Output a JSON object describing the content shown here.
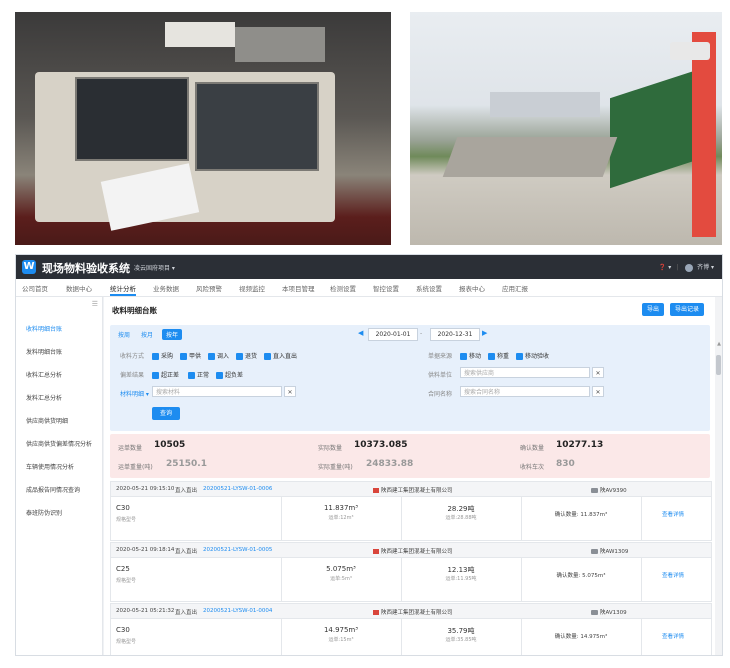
{
  "app": {
    "title": "现场物料验收系统",
    "project": "凌云固府项目 ▾",
    "user": "齐博 ▾",
    "help": "❓ ▾"
  },
  "nav": [
    "公司首页",
    "数据中心",
    "统计分析",
    "业务数据",
    "风险预警",
    "视频监控",
    "本项目管理",
    "检测设置",
    "智控设置",
    "系统设置",
    "报表中心",
    "应用汇报"
  ],
  "sidebar": [
    "收料明细台账",
    "发料明细台账",
    "收料汇总分析",
    "发料汇总分析",
    "供应商供货明细",
    "供应商供货偏差情况分析",
    "车辆使用情况分析",
    "成品报告同情况查询",
    "泰班防伪识别"
  ],
  "page": {
    "title": "收料明细台账",
    "export_label": "导出",
    "export_record_label": "导出记录"
  },
  "filters": {
    "tabs": [
      "按周",
      "按月",
      "按年"
    ],
    "date_from": "2020-01-01",
    "date_sep": "-",
    "date_to": "2020-12-31",
    "row1": {
      "label": "收料方式",
      "opts": [
        "采购",
        "甲供",
        "调入",
        "退货",
        "直入直出"
      ]
    },
    "row1_right": {
      "label": "单据来源",
      "opts": [
        "移动",
        "称重",
        "移动验收"
      ]
    },
    "row2": {
      "label": "偏差结果",
      "opts": [
        "超正差",
        "正常",
        "超负差"
      ]
    },
    "row2_right": {
      "label": "供料单位",
      "placeholder": "搜索供应商"
    },
    "row3": {
      "label": "材料明细 ▾",
      "placeholder": "搜索材料"
    },
    "row3_right": {
      "label": "合同名称",
      "placeholder": "搜索合同名称"
    },
    "query_label": "查询",
    "clear": "✕"
  },
  "summary": {
    "items": [
      {
        "label": "运单数量",
        "value": "10505"
      },
      {
        "label": "实际数量",
        "value": "10373.085"
      },
      {
        "label": "确认数量",
        "value": "10277.13"
      },
      {
        "label": "运单重量(吨)",
        "value": "25150.1"
      },
      {
        "label": "实际重量(吨)",
        "value": "24833.88"
      },
      {
        "label": "收料车次",
        "value": "830"
      }
    ]
  },
  "records": [
    {
      "time": "2020-05-21 09:15:10",
      "type": "直入直出",
      "code": "20200521-LYSW-01-0006",
      "company": "陕西建工集团混凝土有限公司",
      "plate": "陕AV9390",
      "grade": "C30",
      "grade_sub": "规格型号",
      "qty1": "11.837m³",
      "qty1_sub": "运单:12m³",
      "qty2": "28.29吨",
      "qty2_sub": "运单:28.88吨",
      "confirm": "确认数量: 11.837m³",
      "link": "查看详情"
    },
    {
      "time": "2020-05-21 09:18:14",
      "type": "直入直出",
      "code": "20200521-LYSW-01-0005",
      "company": "陕西建工集团混凝土有限公司",
      "plate": "陕AW1309",
      "grade": "C25",
      "grade_sub": "规格型号",
      "qty1": "5.075m³",
      "qty1_sub": "运单:5m³",
      "qty2": "12.13吨",
      "qty2_sub": "运单:11.95吨",
      "confirm": "确认数量: 5.075m³",
      "link": "查看详情"
    },
    {
      "time": "2020-05-21 05:21:32",
      "type": "直入直出",
      "code": "20200521-LYSW-01-0004",
      "company": "陕西建工集团混凝土有限公司",
      "plate": "陕AV1309",
      "grade": "C30",
      "grade_sub": "规格型号",
      "qty1": "14.975m³",
      "qty1_sub": "运单:15m³",
      "qty2": "35.79吨",
      "qty2_sub": "运单:35.85吨",
      "confirm": "确认数量: 14.975m³",
      "link": "查看详情"
    }
  ]
}
